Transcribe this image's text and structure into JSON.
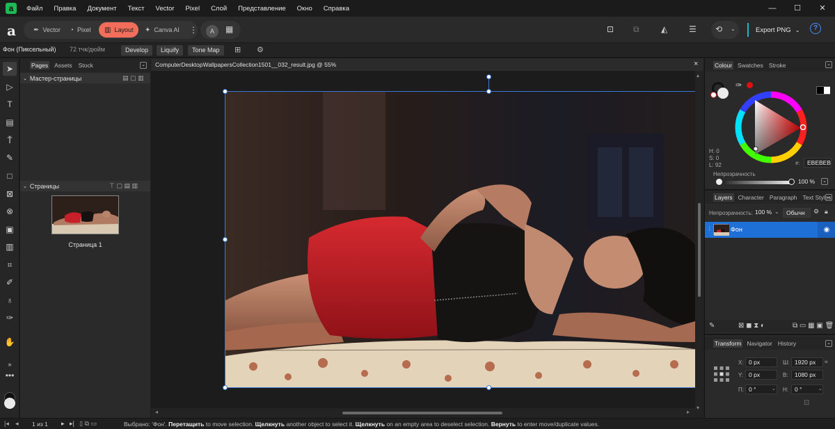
{
  "menubar": {
    "items": [
      "Файл",
      "Правка",
      "Документ",
      "Текст",
      "Vector",
      "Pixel",
      "Слой",
      "Представление",
      "Окно",
      "Справка"
    ]
  },
  "toolbar": {
    "personas": [
      {
        "label": "Vector",
        "icon": "vector-persona-icon"
      },
      {
        "label": "Pixel",
        "icon": "pixel-persona-icon"
      },
      {
        "label": "Layout",
        "icon": "layout-persona-icon"
      },
      {
        "label": "Canva AI",
        "icon": "sparkle-icon"
      }
    ],
    "active_persona": "Layout",
    "export_label": "Export PNG",
    "help_label": "?"
  },
  "context": {
    "layer_name": "Фон (Пиксельный)",
    "dpi": "72 тчк/дюйм",
    "buttons": [
      "Develop",
      "Liquify",
      "Tone Map"
    ]
  },
  "left_panel": {
    "tabs": [
      "Pages",
      "Assets",
      "Stock"
    ],
    "active_tab": "Pages",
    "master_section": "Мастер-страницы",
    "pages_section": "Страницы",
    "page_label": "Страница 1"
  },
  "document": {
    "title": "ComputerDesktopWallpapersCollection1501__032_result.jpg @ 55%",
    "close": "×"
  },
  "colour_panel": {
    "tabs": [
      "Colour",
      "Swatches",
      "Stroke"
    ],
    "active_tab": "Colour",
    "h": "H: 0",
    "s": "S: 0",
    "l": "L: 92",
    "hex": "EBEBEB",
    "hex_prefix": "#:",
    "opacity_label": "Непрозрачность",
    "opacity_value": "100 %"
  },
  "layers_panel": {
    "tabs": [
      "Layers",
      "Character",
      "Paragraph",
      "Text Styles"
    ],
    "active_tab": "Layers",
    "opacity_label": "Непрозрачность:",
    "opacity_value": "100 %",
    "blend_mode": "Обычн",
    "layers": [
      {
        "name": "Фон",
        "selected": true
      }
    ]
  },
  "transform_panel": {
    "tabs": [
      "Transform",
      "Navigator",
      "History"
    ],
    "active_tab": "Transform",
    "x_label": "X:",
    "x_value": "0 px",
    "y_label": "Y:",
    "y_value": "0 px",
    "w_label": "Ш:",
    "w_value": "1920 px",
    "h_label": "В:",
    "h_value": "1080 px",
    "r_label": "П:",
    "r_value": "0 °",
    "s_label": "Н:",
    "s_value": "0 °"
  },
  "status": {
    "page_counter": "1 из 1",
    "msg_prefix": "Выбрано: 'Фон'. ",
    "k1": "Перетащить",
    "t1": " to move selection. ",
    "k2": "Щелкнуть",
    "t2": " another object to select it. ",
    "k3": "Щелкнуть",
    "t3": " on an empty area to deselect selection. ",
    "k4": "Вернуть",
    "t4": " to enter move/duplicate values."
  },
  "colors": {
    "accent": "#f26e5b",
    "selection": "#1e6fd6",
    "handle": "#3b78d8"
  }
}
